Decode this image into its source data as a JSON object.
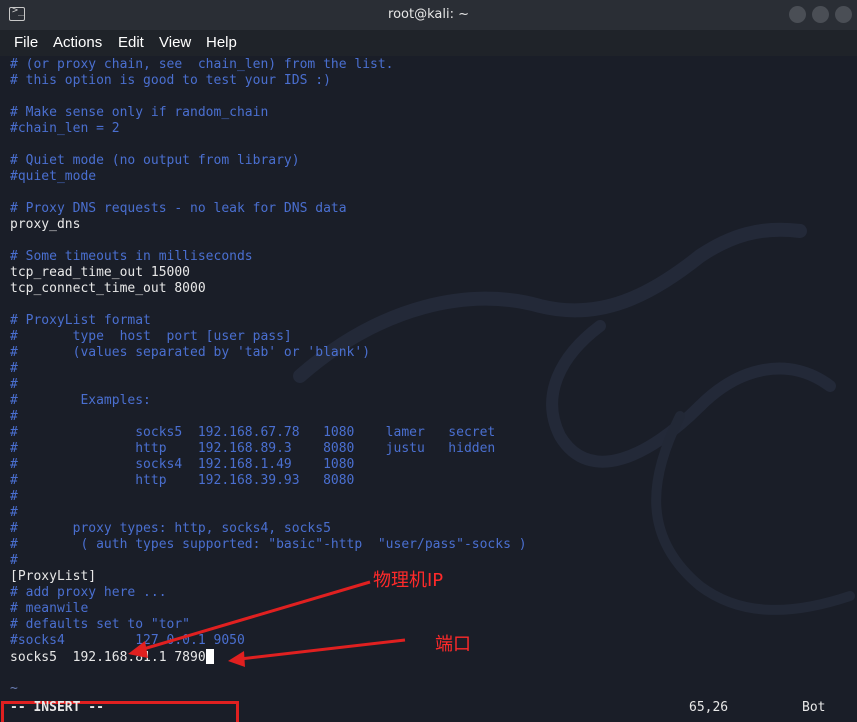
{
  "window": {
    "title": "root@kali: ~"
  },
  "menu": [
    "File",
    "Actions",
    "Edit",
    "View",
    "Help"
  ],
  "lines": [
    {
      "text": "# (or proxy chain, see  chain_len) from the list.",
      "style": "c"
    },
    {
      "text": "# this option is good to test your IDS :)",
      "style": "c"
    },
    {
      "text": "",
      "style": "c"
    },
    {
      "text": "# Make sense only if random_chain",
      "style": "c"
    },
    {
      "text": "#chain_len = 2",
      "style": "c"
    },
    {
      "text": "",
      "style": "c"
    },
    {
      "text": "# Quiet mode (no output from library)",
      "style": "c"
    },
    {
      "text": "#quiet_mode",
      "style": "c"
    },
    {
      "text": "",
      "style": "c"
    },
    {
      "text": "# Proxy DNS requests - no leak for DNS data",
      "style": "c"
    },
    {
      "text": "proxy_dns",
      "style": "w"
    },
    {
      "text": "",
      "style": "c"
    },
    {
      "text": "# Some timeouts in milliseconds",
      "style": "c"
    },
    {
      "text": "tcp_read_time_out 15000",
      "style": "w"
    },
    {
      "text": "tcp_connect_time_out 8000",
      "style": "w"
    },
    {
      "text": "",
      "style": "c"
    },
    {
      "text": "# ProxyList format",
      "style": "c"
    },
    {
      "text": "#       type  host  port [user pass]",
      "style": "c"
    },
    {
      "text": "#       (values separated by 'tab' or 'blank')",
      "style": "c"
    },
    {
      "text": "#",
      "style": "c"
    },
    {
      "text": "#",
      "style": "c"
    },
    {
      "text": "#        Examples:",
      "style": "c"
    },
    {
      "text": "#",
      "style": "c"
    },
    {
      "text": "#               socks5  192.168.67.78   1080    lamer   secret",
      "style": "c"
    },
    {
      "text": "#               http    192.168.89.3    8080    justu   hidden",
      "style": "c"
    },
    {
      "text": "#               socks4  192.168.1.49    1080",
      "style": "c"
    },
    {
      "text": "#               http    192.168.39.93   8080",
      "style": "c"
    },
    {
      "text": "#",
      "style": "c"
    },
    {
      "text": "#",
      "style": "c"
    },
    {
      "text": "#       proxy types: http, socks4, socks5",
      "style": "c"
    },
    {
      "text": "#        ( auth types supported: \"basic\"-http  \"user/pass\"-socks )",
      "style": "c"
    },
    {
      "text": "#",
      "style": "c"
    },
    {
      "text": "[ProxyList]",
      "style": "w"
    },
    {
      "text": "# add proxy here ...",
      "style": "c"
    },
    {
      "text": "# meanwile",
      "style": "c"
    },
    {
      "text": "# defaults set to \"tor\"",
      "style": "c"
    },
    {
      "text": "#socks4         127.0.0.1 9050",
      "style": "c"
    },
    {
      "text": "socks5  192.168.81.1 7890",
      "style": "w",
      "cursor": true
    },
    {
      "text": "",
      "style": "c"
    },
    {
      "text": "~",
      "style": "t"
    }
  ],
  "status": {
    "mode": "-- INSERT --",
    "position": "65,26",
    "scroll": "Bot"
  },
  "annotations": {
    "ip_label": "物理机IP",
    "port_label": "端口",
    "color": "#ff2a2a"
  },
  "colors": {
    "comment": "#4a6fd0",
    "text": "#e8e8e8",
    "background": "#1a1e28"
  }
}
